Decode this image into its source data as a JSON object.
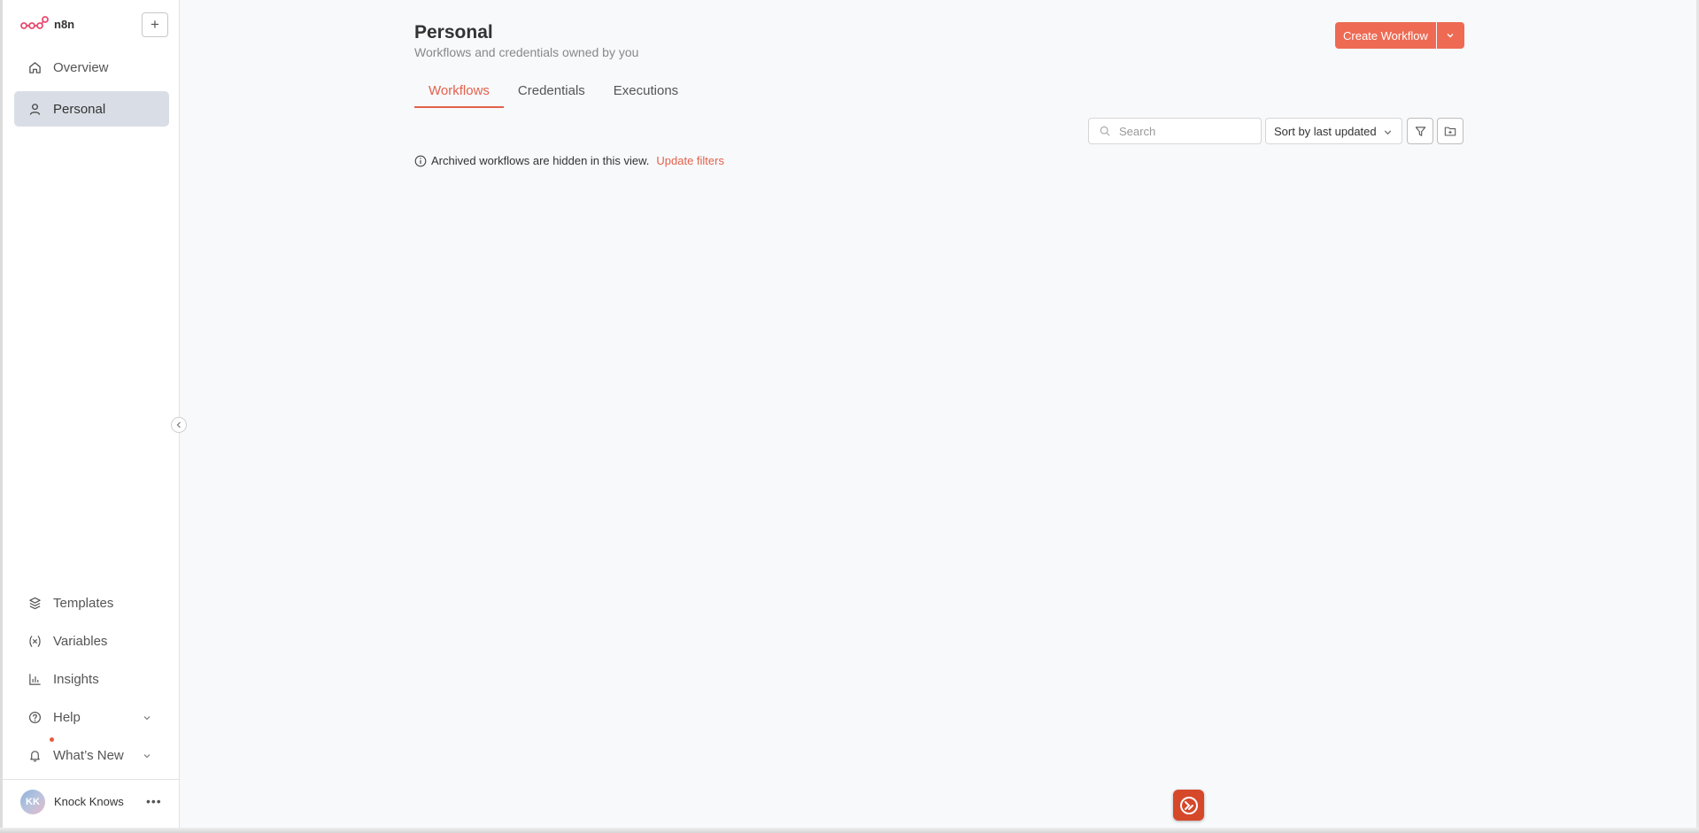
{
  "sidebar": {
    "brand": "n8n",
    "new_button_label": "+",
    "top_items": [
      {
        "label": "Overview",
        "icon": "home-icon"
      },
      {
        "label": "Personal",
        "icon": "user-icon",
        "active": true
      }
    ],
    "bottom_items": [
      {
        "label": "Templates",
        "icon": "templates-icon"
      },
      {
        "label": "Variables",
        "icon": "variables-icon"
      },
      {
        "label": "Insights",
        "icon": "chart-icon"
      },
      {
        "label": "Help",
        "icon": "help-icon"
      },
      {
        "label": "What’s New",
        "icon": "bell-icon"
      }
    ],
    "user": {
      "initials": "KK",
      "name": "Knock Knows"
    }
  },
  "header": {
    "title": "Personal",
    "subtitle": "Workflows and credentials owned by you",
    "create_label": "Create Workflow"
  },
  "tabs": [
    {
      "label": "Workflows",
      "active": true
    },
    {
      "label": "Credentials"
    },
    {
      "label": "Executions"
    }
  ],
  "toolbar": {
    "search_placeholder": "Search",
    "sort_value": "Sort by last updated"
  },
  "notice": {
    "text": "Archived workflows are hidden in this view.",
    "link": "Update filters"
  },
  "colors": {
    "accent": "#ee6a53",
    "active_nav": "#d9dee6"
  }
}
